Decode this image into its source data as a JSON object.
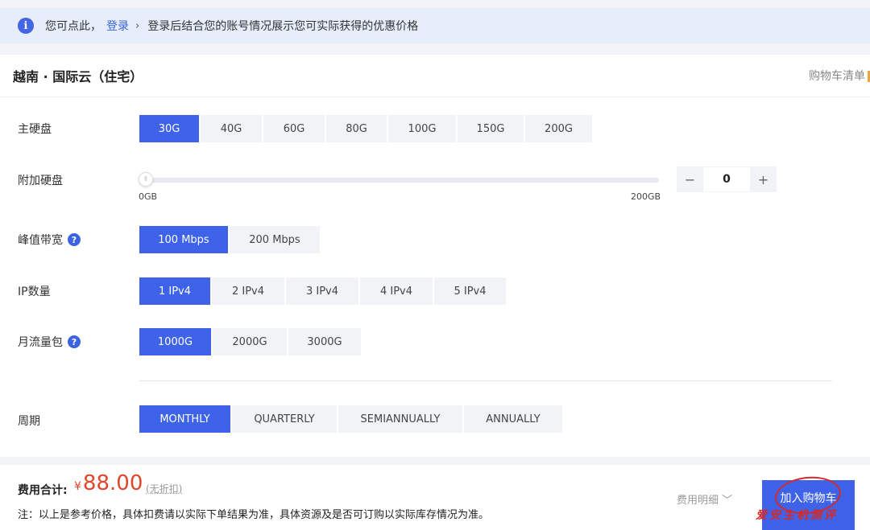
{
  "notice": {
    "prefix": "您可点此，",
    "login_label": "登录",
    "chevron": "›",
    "message": "登录后结合您的账号情况展示您可实际获得的优惠价格",
    "icon": "info-icon"
  },
  "header": {
    "title": "越南 · 国际云（住宅）",
    "cart_list": "购物车清单"
  },
  "main_disk": {
    "label": "主硬盘",
    "options": [
      "30G",
      "40G",
      "60G",
      "80G",
      "100G",
      "150G",
      "200G"
    ],
    "selected": "30G"
  },
  "extra_disk": {
    "label": "附加硬盘",
    "min_label": "0GB",
    "max_label": "200GB",
    "value": "0",
    "minus": "−",
    "plus": "+",
    "thumb_glyph": "⦀"
  },
  "bandwidth": {
    "label": "峰值带宽",
    "help": "?",
    "options": [
      "100 Mbps",
      "200 Mbps"
    ],
    "selected": "100 Mbps"
  },
  "ip_count": {
    "label": "IP数量",
    "options": [
      "1 IPv4",
      "2 IPv4",
      "3 IPv4",
      "4 IPv4",
      "5 IPv4"
    ],
    "selected": "1 IPv4"
  },
  "traffic": {
    "label": "月流量包",
    "help": "?",
    "options": [
      "1000G",
      "2000G",
      "3000G"
    ],
    "selected": "1000G"
  },
  "period": {
    "label": "周期",
    "options": [
      "MONTHLY",
      "QUARTERLY",
      "SEMIANNUALLY",
      "ANNUALLY"
    ],
    "selected": "MONTHLY"
  },
  "footer": {
    "total_label": "费用合计:",
    "currency": "¥",
    "amount": "88.00",
    "no_discount": "(无折扣)",
    "note": "注：以上是参考价格，具体扣费请以实际下单结果为准，具体资源及是否可订购以实际库存情况为准。",
    "detail": "费用明细 ﹀",
    "add_to_cart": "加入购物车"
  },
  "watermark": "爱安主机测评",
  "colors": {
    "accent": "#3f63e8",
    "price": "#e0462b",
    "notice_bg": "#e6edfb"
  }
}
